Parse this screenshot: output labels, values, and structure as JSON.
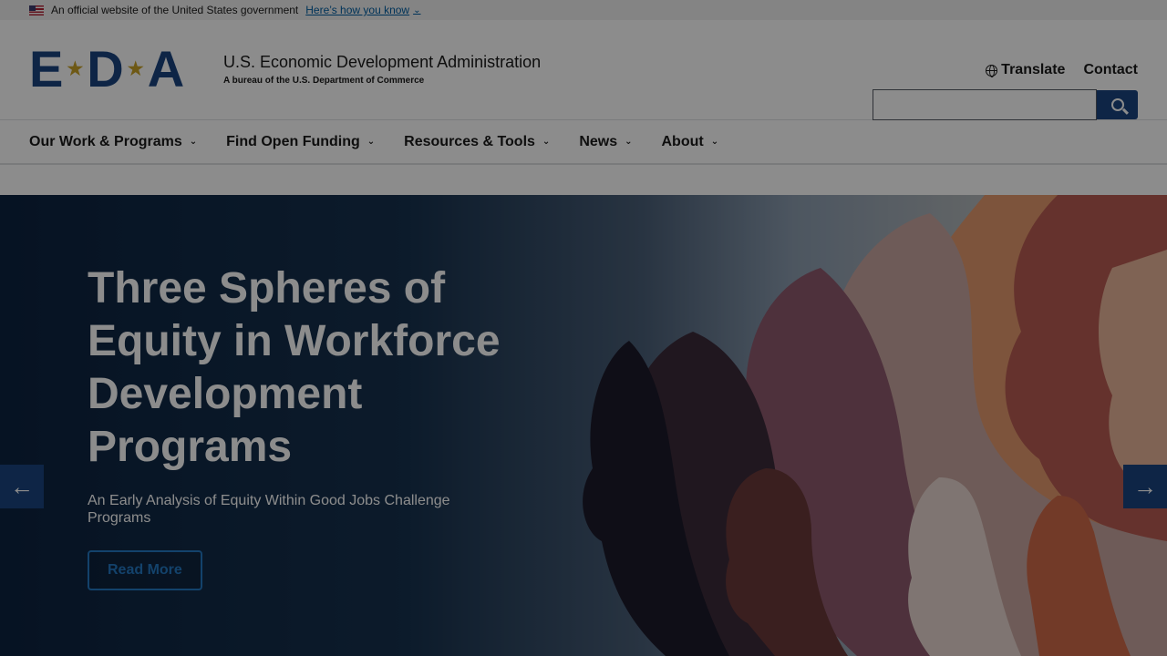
{
  "gov_banner": {
    "text": "An official website of the United States government",
    "link": "Here’s how you know"
  },
  "header": {
    "logo_letters": [
      "E",
      "D",
      "A"
    ],
    "title": "U.S. Economic Development Administration",
    "subtitle": "A bureau of the U.S. Department of Commerce",
    "translate_label": "Translate",
    "contact_label": "Contact",
    "search_value": ""
  },
  "nav": {
    "items": [
      {
        "label": "Our Work & Programs"
      },
      {
        "label": "Find Open Funding"
      },
      {
        "label": "Resources & Tools"
      },
      {
        "label": "News"
      },
      {
        "label": "About"
      }
    ]
  },
  "hero": {
    "title": "Three Spheres of Equity in Workforce Development Programs",
    "subtitle": "An Early Analysis of Equity Within Good Jobs Challenge Programs",
    "button_label": "Read More",
    "prev_icon": "arrow-left-icon",
    "next_icon": "arrow-right-icon"
  },
  "colors": {
    "brand_blue": "#1a4480",
    "link_blue": "#005ea2",
    "accent_gold": "#c9a227"
  }
}
